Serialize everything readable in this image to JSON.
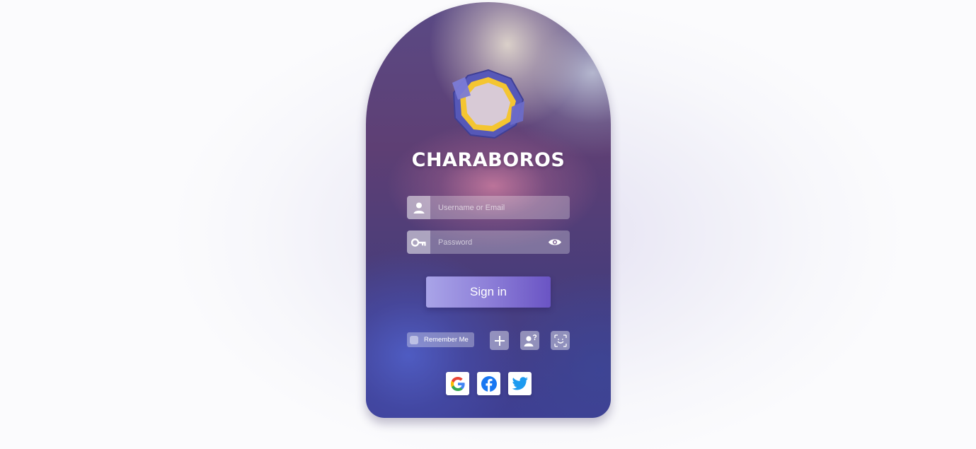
{
  "brand": {
    "name": "CHARABOROS",
    "logo_icon": "hexagonal-ring-logo"
  },
  "login": {
    "username_placeholder": "Username or Email",
    "password_placeholder": "Password",
    "sign_in_label": "Sign in",
    "remember_label": "Remember Me"
  },
  "actions": [
    {
      "icon": "plus-icon",
      "meaning": "create account"
    },
    {
      "icon": "user-question-icon",
      "meaning": "account help"
    },
    {
      "icon": "face-id-icon",
      "meaning": "face login"
    }
  ],
  "social": [
    {
      "icon": "google-icon"
    },
    {
      "icon": "facebook-icon"
    },
    {
      "icon": "twitter-icon"
    }
  ],
  "colors": {
    "accent_start": "#a9a4e8",
    "accent_end": "#6a54c4",
    "logo_blue": "#5a5bc0",
    "logo_gold": "#f4c531",
    "facebook": "#1877f2",
    "twitter": "#1d9bf0"
  }
}
